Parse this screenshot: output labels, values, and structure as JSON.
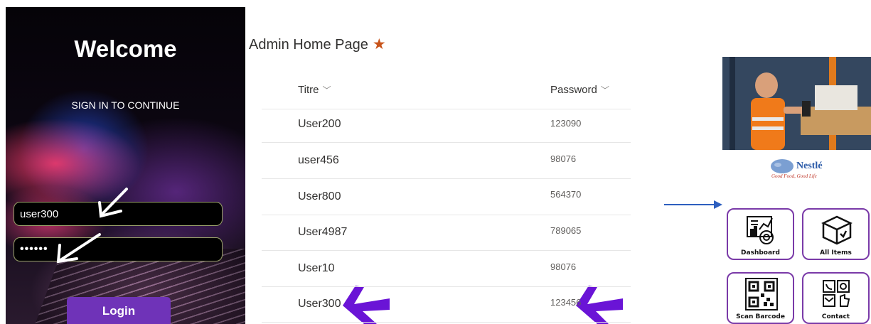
{
  "login": {
    "title": "Welcome",
    "subtitle": "SIGN IN TO CONTINUE",
    "username_value": "user300",
    "password_value": "••••••",
    "button_label": "Login"
  },
  "admin": {
    "title": "Admin Home Page",
    "columns": [
      "Titre",
      "Password"
    ],
    "rows": [
      {
        "title": "User200",
        "password": "123090"
      },
      {
        "title": "user456",
        "password": "98076"
      },
      {
        "title": "User800",
        "password": "564370"
      },
      {
        "title": "User4987",
        "password": "789065"
      },
      {
        "title": "User10",
        "password": "98076"
      },
      {
        "title": "User300",
        "password": "123456"
      }
    ]
  },
  "app": {
    "brand": "Nestlé",
    "tagline": "Good Food, Good Life",
    "tiles": [
      "Dashboard",
      "All Items",
      "Scan Barcode",
      "Contact"
    ]
  },
  "colors": {
    "accent_purple": "#6f33b8",
    "star": "#c8541b",
    "annotation_arrow": "#6a14d6",
    "pointer_arrow": "#2e5fbf"
  }
}
